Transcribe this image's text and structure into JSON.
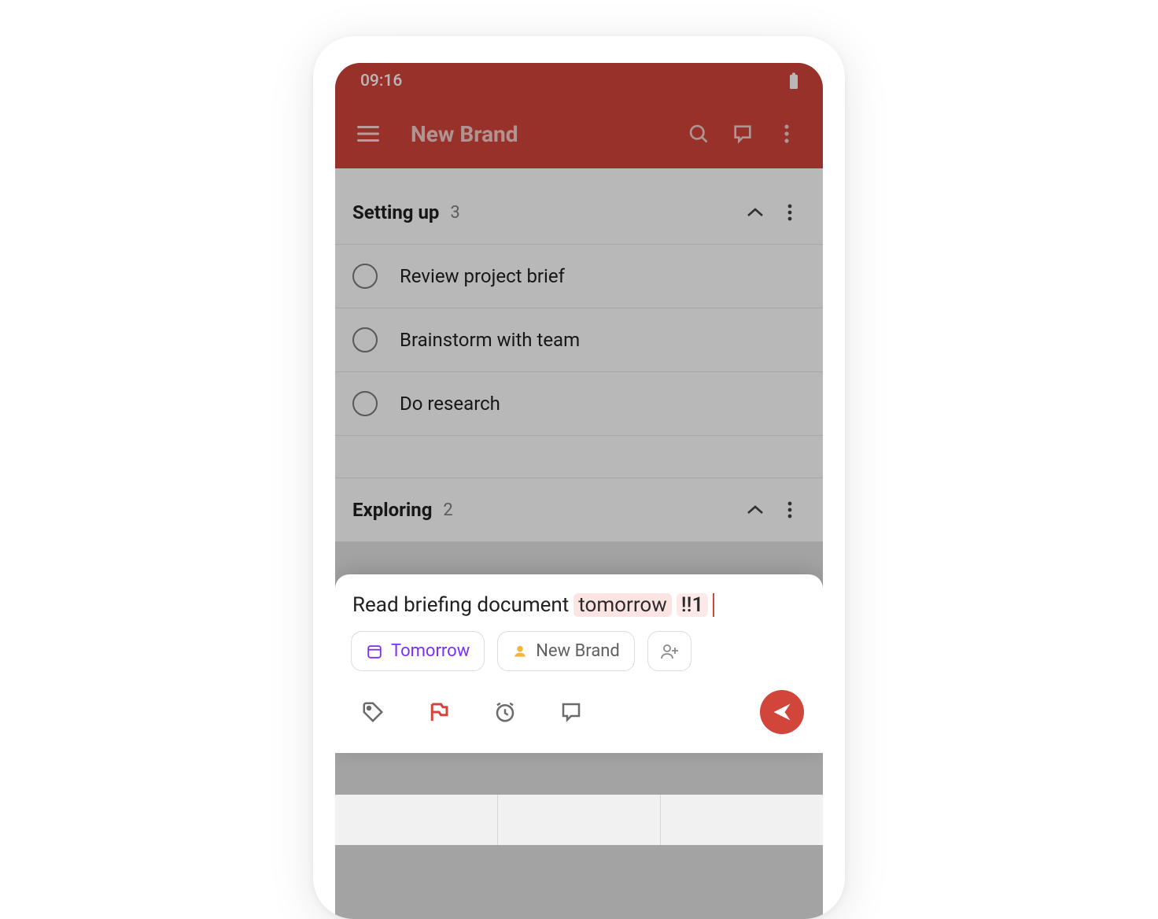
{
  "status": {
    "time": "09:16"
  },
  "appbar": {
    "title": "New Brand"
  },
  "sections": [
    {
      "title": "Setting up",
      "count": "3"
    },
    {
      "title": "Exploring",
      "count": "2"
    }
  ],
  "tasks": [
    {
      "title": "Review project brief"
    },
    {
      "title": "Brainstorm with team"
    },
    {
      "title": "Do research"
    }
  ],
  "quickadd": {
    "text_prefix": "Read briefing document",
    "date_token": "tomorrow",
    "priority_token": "!!1",
    "chips": {
      "date": "Tomorrow",
      "project": "New Brand"
    }
  }
}
